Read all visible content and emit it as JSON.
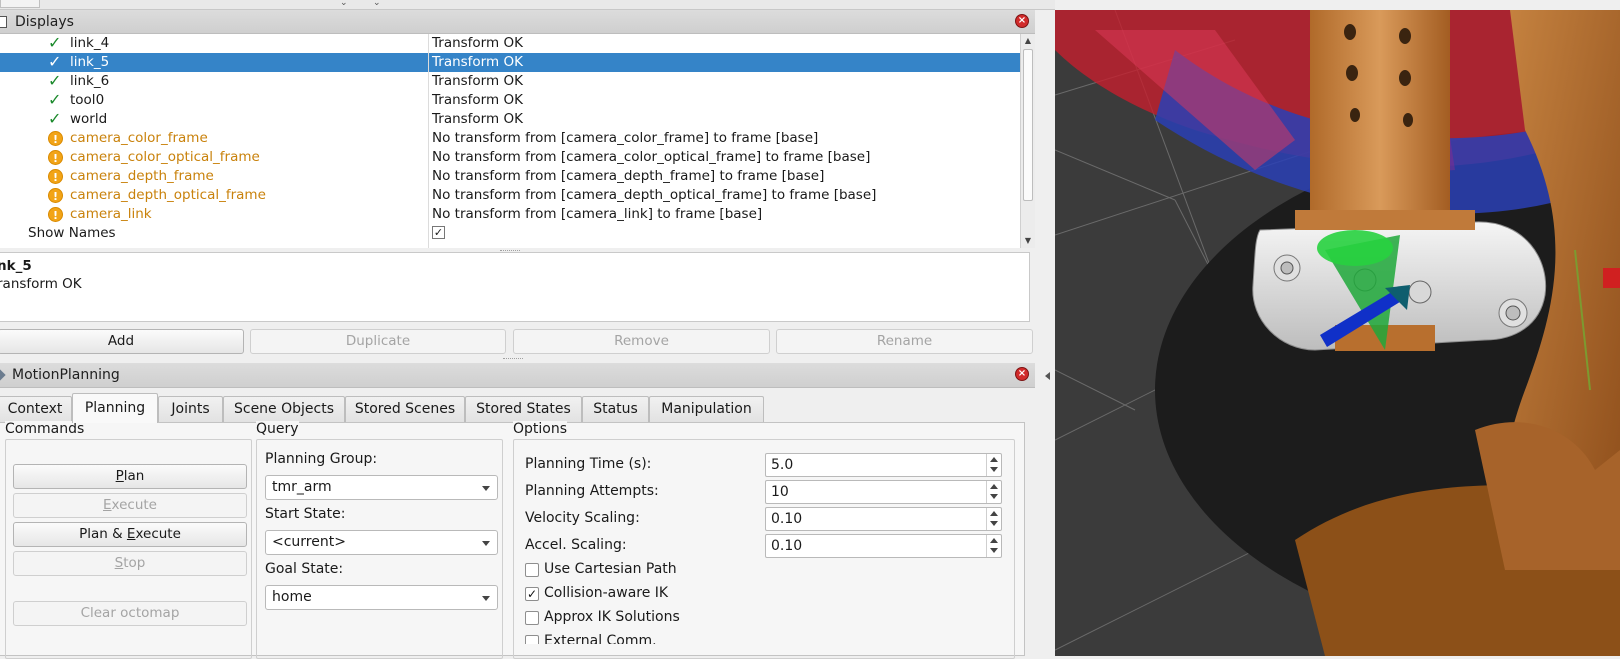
{
  "displays": {
    "title": "Displays",
    "rows": [
      {
        "name": "link_4",
        "status": "Transform OK",
        "state": "ok"
      },
      {
        "name": "link_5",
        "status": "Transform OK",
        "state": "ok"
      },
      {
        "name": "link_6",
        "status": "Transform OK",
        "state": "ok"
      },
      {
        "name": "tool0",
        "status": "Transform OK",
        "state": "ok"
      },
      {
        "name": "world",
        "status": "Transform OK",
        "state": "ok"
      },
      {
        "name": "camera_color_frame",
        "status": "No transform from [camera_color_frame] to frame [base]",
        "state": "warn"
      },
      {
        "name": "camera_color_optical_frame",
        "status": "No transform from [camera_color_optical_frame] to frame [base]",
        "state": "warn"
      },
      {
        "name": "camera_depth_frame",
        "status": "No transform from [camera_depth_frame] to frame [base]",
        "state": "warn"
      },
      {
        "name": "camera_depth_optical_frame",
        "status": "No transform from [camera_depth_optical_frame] to frame [base]",
        "state": "warn"
      },
      {
        "name": "camera_link",
        "status": "No transform from [camera_link] to frame [base]",
        "state": "warn"
      }
    ],
    "show_names_label": "Show Names",
    "show_names_checked": "✓",
    "selected_index": 1
  },
  "description": {
    "title": "nk_5",
    "text": "ransform OK"
  },
  "display_buttons": {
    "add": "Add",
    "duplicate": "Duplicate",
    "remove": "Remove",
    "rename": "Rename"
  },
  "motion_planning": {
    "title": "MotionPlanning",
    "tabs": [
      "Context",
      "Planning",
      "Joints",
      "Scene Objects",
      "Stored Scenes",
      "Stored States",
      "Status",
      "Manipulation"
    ],
    "active_tab": "Planning",
    "commands": {
      "title": "Commands",
      "plan": "Plan",
      "execute": "Execute",
      "plan_execute": "Plan & Execute",
      "stop": "Stop",
      "clear_octomap": "Clear octomap"
    },
    "query": {
      "title": "Query",
      "planning_group_label": "Planning Group:",
      "planning_group_value": "tmr_arm",
      "start_state_label": "Start State:",
      "start_state_value": "<current>",
      "goal_state_label": "Goal State:",
      "goal_state_value": "home"
    },
    "options": {
      "title": "Options",
      "planning_time_label": "Planning Time (s):",
      "planning_time_value": "5.0",
      "planning_attempts_label": "Planning Attempts:",
      "planning_attempts_value": "10",
      "velocity_scaling_label": "Velocity Scaling:",
      "velocity_scaling_value": "0.10",
      "accel_scaling_label": "Accel. Scaling:",
      "accel_scaling_value": "0.10",
      "use_cartesian_label": "Use Cartesian Path",
      "use_cartesian_checked": false,
      "collision_aware_label": "Collision-aware IK",
      "collision_aware_checked": true,
      "approx_ik_label": "Approx IK Solutions",
      "approx_ik_checked": false,
      "external_comm_label": "External Comm."
    }
  },
  "colors": {
    "selection": "#3584c8",
    "ok_check": "#1b8a2c",
    "warn": "#f2a417",
    "warn_text": "#c9820c",
    "viewport_bg": "#3b3b3b"
  }
}
